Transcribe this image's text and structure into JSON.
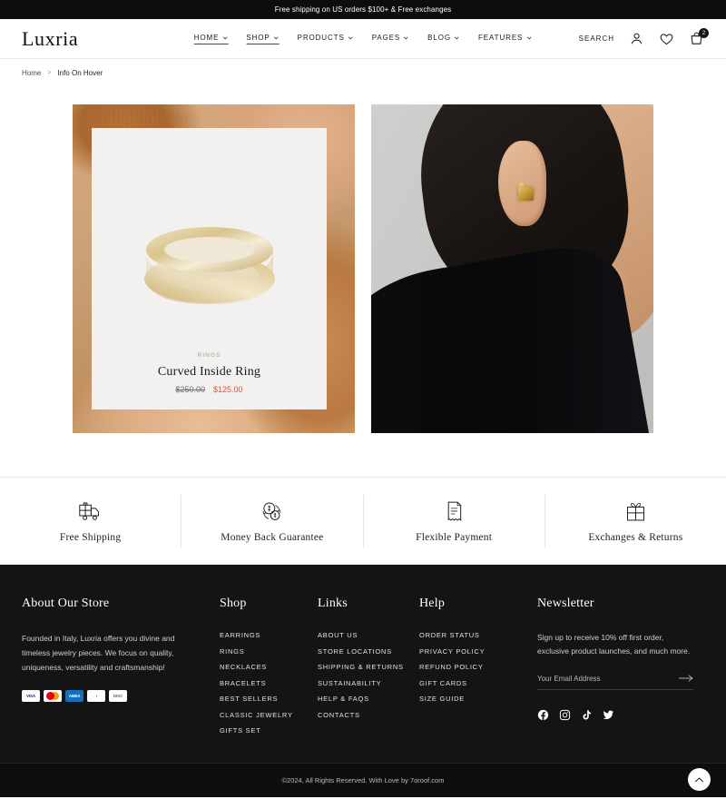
{
  "announcement": {
    "text": "Free shipping on US orders $100+ & Free exchanges"
  },
  "header": {
    "logo": "Luxria",
    "nav": [
      {
        "label": "HOME",
        "active": false
      },
      {
        "label": "SHOP",
        "active": true
      },
      {
        "label": "PRODUCTS",
        "active": false
      },
      {
        "label": "PAGES",
        "active": false
      },
      {
        "label": "BLOG",
        "active": false
      },
      {
        "label": "FEATURES",
        "active": false
      }
    ],
    "search_label": "SEARCH",
    "account_icon": "user-icon",
    "wishlist_icon": "heart-icon",
    "cart_icon": "shopping-bag-icon",
    "cart_count": "2"
  },
  "breadcrumb": {
    "home": "Home",
    "separator": ">",
    "current": "Info On Hover"
  },
  "gallery": {
    "product_card": {
      "category": "RINGS",
      "title": "Curved Inside Ring",
      "price_old": "$250.00",
      "price_new": "$125.00",
      "sale_color": "#e8503a"
    },
    "image_one_alt": "hand-holding-gold-ring",
    "image_two_alt": "model-wearing-gold-earring"
  },
  "features": [
    {
      "icon": "delivery-truck-icon",
      "label": "Free Shipping"
    },
    {
      "icon": "money-back-icon",
      "label": "Money Back Guarantee"
    },
    {
      "icon": "receipt-icon",
      "label": "Flexible Payment"
    },
    {
      "icon": "gift-box-icon",
      "label": "Exchanges & Returns"
    }
  ],
  "footer": {
    "about": {
      "heading": "About Our Store",
      "body": "Founded in Italy, Luxria offers you divine and timeless jewelry pieces. We focus on quality, uniqueness, versatility and craftsmanship!",
      "payments": [
        "VISA",
        "Mastercard",
        "AMEX",
        "Diners Club",
        "Discover"
      ]
    },
    "shop": {
      "heading": "Shop",
      "items": [
        "EARRINGS",
        "RINGS",
        "NECKLACES",
        "BRACELETS",
        "BEST SELLERS",
        "CLASSIC JEWELRY",
        "GIFTS SET"
      ]
    },
    "links": {
      "heading": "Links",
      "items": [
        "ABOUT US",
        "STORE LOCATIONS",
        "SHIPPING & RETURNS",
        "SUSTAINABILITY",
        "HELP & FAQS",
        "CONTACTS"
      ]
    },
    "help": {
      "heading": "Help",
      "items": [
        "ORDER STATUS",
        "PRIVACY POLICY",
        "REFUND POLICY",
        "GIFT CARDS",
        "SIZE GUIDE"
      ]
    },
    "newsletter": {
      "heading": "Newsletter",
      "body": "Sign up to receive 10% off first order, exclusive product launches, and much more.",
      "placeholder": "Your Email Address",
      "value": "",
      "submit_icon": "arrow-right-icon",
      "socials": [
        "facebook-icon",
        "instagram-icon",
        "tiktok-icon",
        "twitter-icon"
      ]
    }
  },
  "copyright": {
    "text": "©2024, All Rights Reserved. With Love by 7oroof.com"
  },
  "scroll_top": {
    "icon": "chevron-up-icon"
  }
}
